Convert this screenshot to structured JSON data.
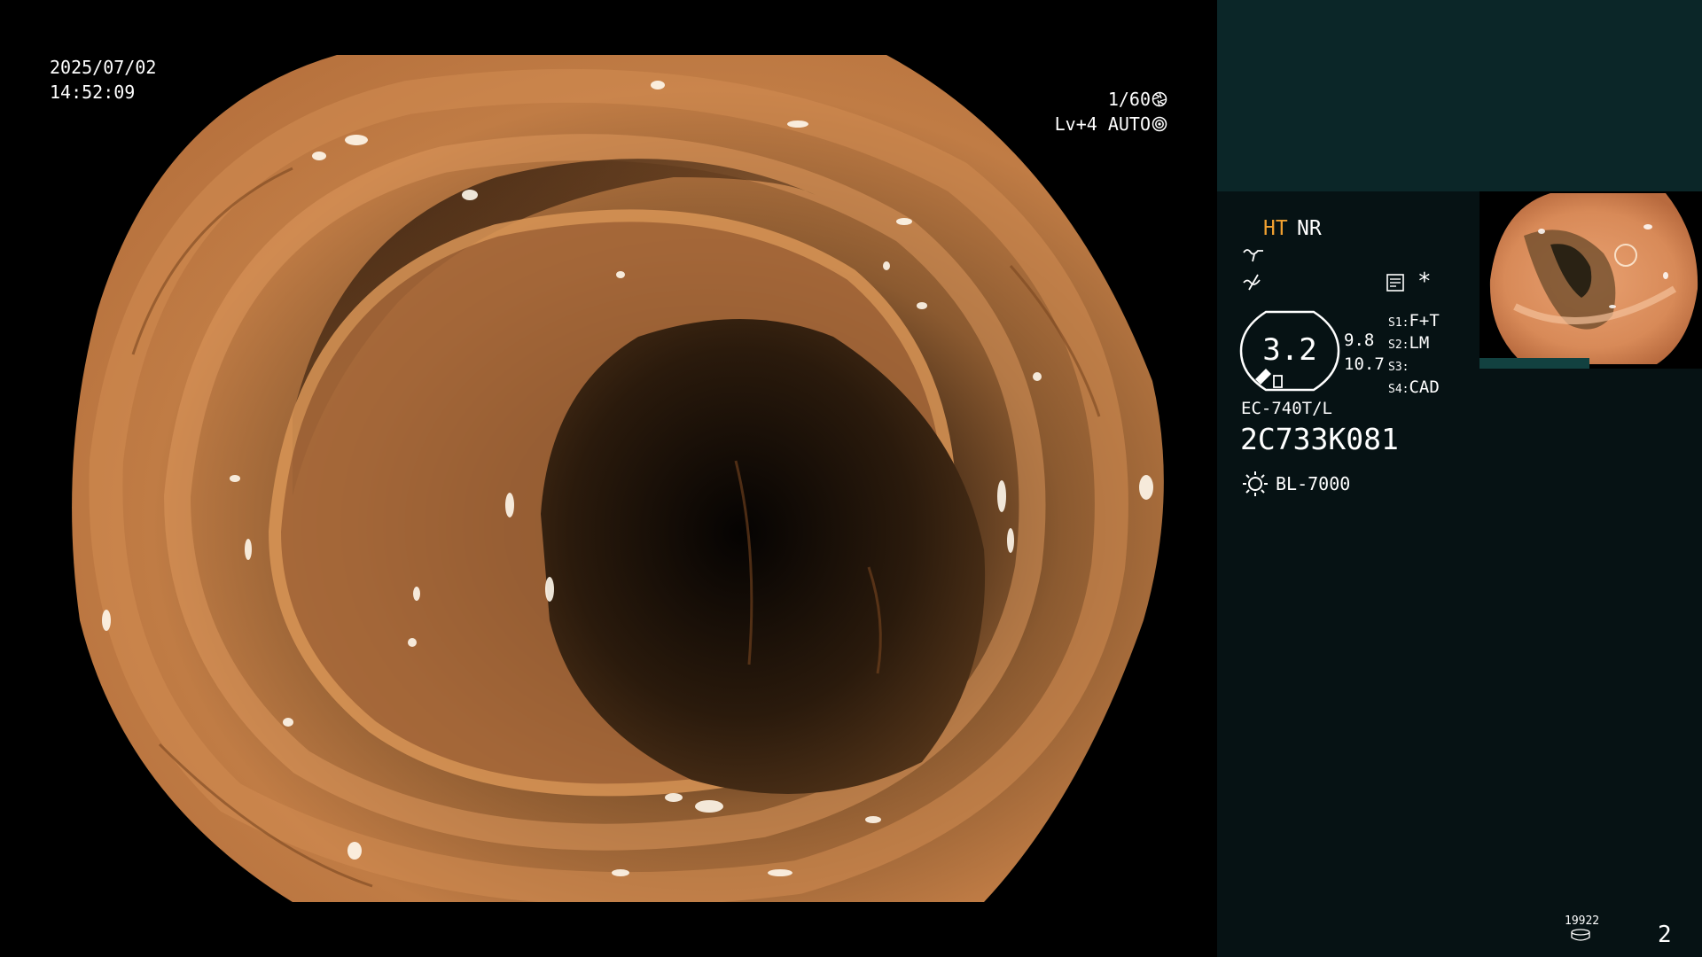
{
  "overlay": {
    "date": "2025/07/02",
    "time": "14:52:09",
    "shutter": "1/60",
    "shutter_icon": "aperture-icon",
    "level": "Lv+4",
    "exposure_mode": "AUTO",
    "exposure_icon": "gear-icon"
  },
  "panel": {
    "image_mode": "HT",
    "noise_reduction": "NR",
    "mode_icons": [
      "tilde-wave-icon",
      "slash-wave-icon"
    ],
    "record_icon": "record-settings-icon",
    "star_mark": "*",
    "zoom": "3.2",
    "zoom_aux_1": "9.8",
    "zoom_aux_2": "10.7",
    "switches": [
      {
        "key": "S1:",
        "value": "F+T"
      },
      {
        "key": "S2:",
        "value": "LM"
      },
      {
        "key": "S3:",
        "value": ""
      },
      {
        "key": "S4:",
        "value": "CAD"
      }
    ],
    "scope_model": "EC-740T/L",
    "scope_serial": "2C733K081",
    "light_icon": "sun-icon",
    "light_source": "BL-7000",
    "counter": "19922",
    "counter_icon": "disc-stack-icon",
    "page_number": "2"
  },
  "colors": {
    "panel_bg": "#061214",
    "panel_top_band": "#0b2628",
    "accent_orange": "#f0a030",
    "tissue": "#b8743f"
  }
}
